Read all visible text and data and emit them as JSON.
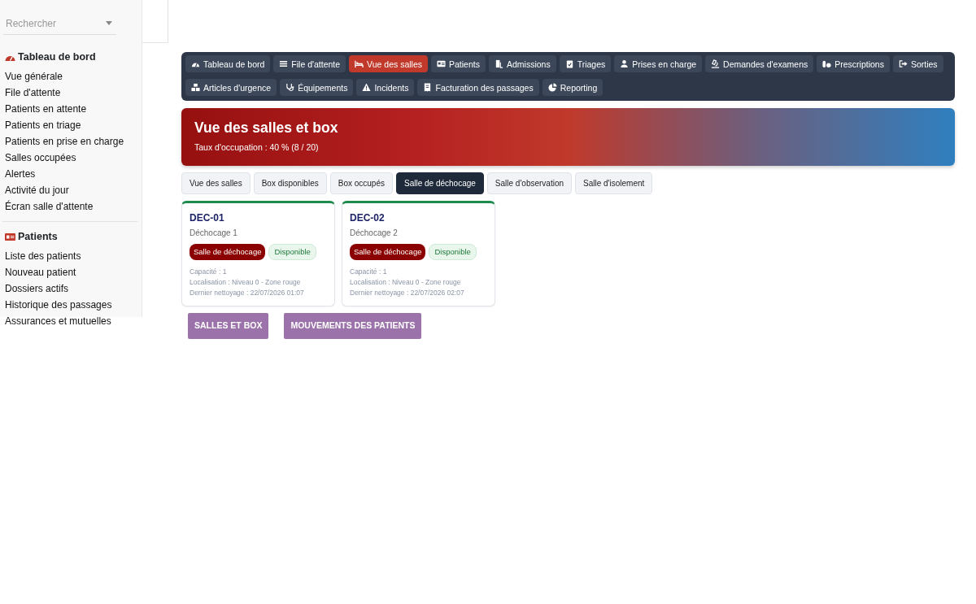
{
  "sidebar": {
    "search": {
      "placeholder": "Rechercher"
    },
    "sections": [
      {
        "title": "Tableau de bord",
        "items": [
          "Vue générale",
          "File d'attente",
          "Patients en attente",
          "Patients en triage",
          "Patients en prise en charge",
          "Salles occupées",
          "Alertes",
          "Activité du jour",
          "Écran salle d'attente"
        ]
      },
      {
        "title": "Patients",
        "items": [
          "Liste des patients",
          "Nouveau patient",
          "Dossiers actifs",
          "Historique des passages",
          "Assurances et mutuelles"
        ]
      }
    ]
  },
  "nav": [
    {
      "label": "Tableau de bord",
      "selected": false
    },
    {
      "label": "File d'attente",
      "selected": false
    },
    {
      "label": "Vue des salles",
      "selected": true
    },
    {
      "label": "Patients",
      "selected": false
    },
    {
      "label": "Admissions",
      "selected": false
    },
    {
      "label": "Triages",
      "selected": false
    },
    {
      "label": "Prises en charge",
      "selected": false
    },
    {
      "label": "Demandes d'examens",
      "selected": false
    },
    {
      "label": "Prescriptions",
      "selected": false
    },
    {
      "label": "Sorties",
      "selected": false
    },
    {
      "label": "Articles d'urgence",
      "selected": false
    },
    {
      "label": "Équipements",
      "selected": false
    },
    {
      "label": "Incidents",
      "selected": false
    },
    {
      "label": "Facturation des passages",
      "selected": false
    },
    {
      "label": "Reporting",
      "selected": false
    }
  ],
  "hero": {
    "title": "Vue des salles et box",
    "subtitle": "Taux d'occupation : 40 % (8 / 20)"
  },
  "filters": [
    {
      "label": "Vue des salles",
      "selected": false
    },
    {
      "label": "Box disponibles",
      "selected": false
    },
    {
      "label": "Box occupés",
      "selected": false
    },
    {
      "label": "Salle de déchocage",
      "selected": true
    },
    {
      "label": "Salle d'observation",
      "selected": false
    },
    {
      "label": "Salle d'isolement",
      "selected": false
    }
  ],
  "rooms": [
    {
      "code": "DEC-01",
      "name": "Déchocage 1",
      "type": "Salle de déchocage",
      "status": "Disponible",
      "available": true,
      "capacity": "Capacité : 1",
      "location": "Localisation : Niveau 0 - Zone rouge",
      "cleaning": "Dernier nettoyage : 22/07/2026 01:07"
    },
    {
      "code": "DEC-02",
      "name": "Déchocage 2",
      "type": "Salle de déchocage",
      "status": "Disponible",
      "available": true,
      "capacity": "Capacité : 1",
      "location": "Localisation : Niveau 0 - Zone rouge",
      "cleaning": "Dernier nettoyage : 22/07/2026 02:07"
    }
  ],
  "actions": [
    "SALLES ET BOX",
    "MOUVEMENTS DES PATIENTS"
  ]
}
